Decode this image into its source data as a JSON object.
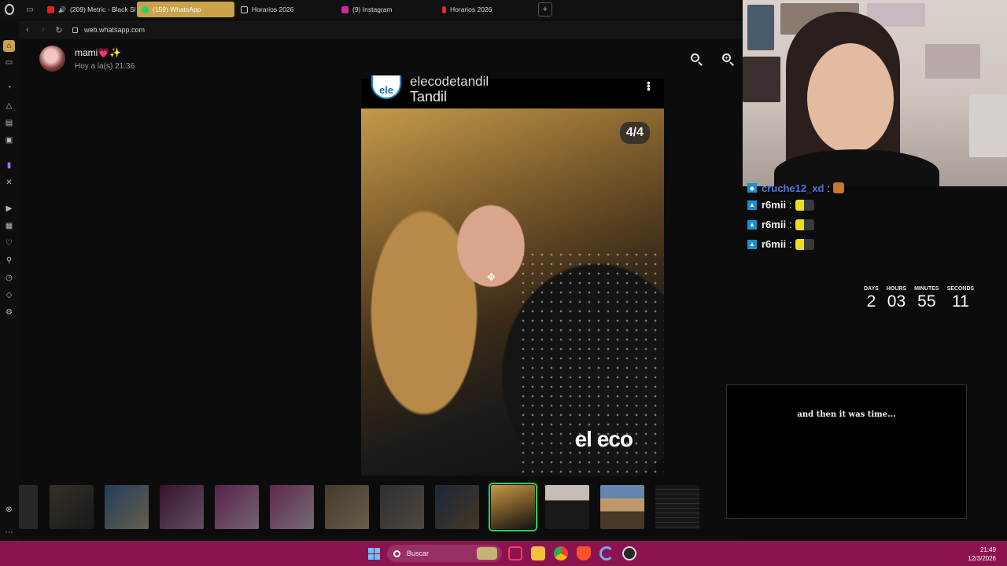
{
  "browser": {
    "tabs": [
      {
        "label": "(209) Metric - Black Sh",
        "favicon": "youtube-icon",
        "color": "#e62117"
      },
      {
        "label": "(159) WhatsApp",
        "favicon": "whatsapp-icon",
        "color": "#25d366"
      },
      {
        "label": "Horarios 2026",
        "favicon": "document-icon",
        "color": "#cccccc"
      },
      {
        "label": "(9) Instagram",
        "favicon": "instagram-icon",
        "color": "#d6249f"
      },
      {
        "label": "Horarios 2026",
        "favicon": "pdf-icon",
        "color": "#d93025"
      }
    ],
    "active_tab_color": "#c9a24a",
    "url": "web.whatsapp.com"
  },
  "viewer": {
    "contact_name": "mami💗✨",
    "contact_time": "Hoy a la(s) 21:36",
    "post_title": "elecodetandil",
    "post_subtitle": "Tandil",
    "post_logo": "ele",
    "photo_counter": "4/4",
    "photo_watermark": "el eco",
    "active_thumb_color": "#25d366"
  },
  "chat": {
    "lines": [
      {
        "user": "cruche12_xd",
        "text": ":",
        "partial": true
      },
      {
        "user": "r6mii",
        "text": ":"
      },
      {
        "user": "r6mii",
        "text": ":"
      },
      {
        "user": "r6mii",
        "text": ":"
      }
    ]
  },
  "countdown": {
    "days_label": "DAYS",
    "days": "2",
    "hours_label": "HOURS",
    "hours": "03",
    "minutes_label": "MINUTES",
    "minutes": "55",
    "seconds_label": "SECONDS",
    "seconds": "11"
  },
  "caption": {
    "text": "and then it was time..."
  },
  "taskbar": {
    "search_label": "Buscar",
    "time": "21:49",
    "date": "12/3/2026",
    "color": "#8b1450"
  }
}
